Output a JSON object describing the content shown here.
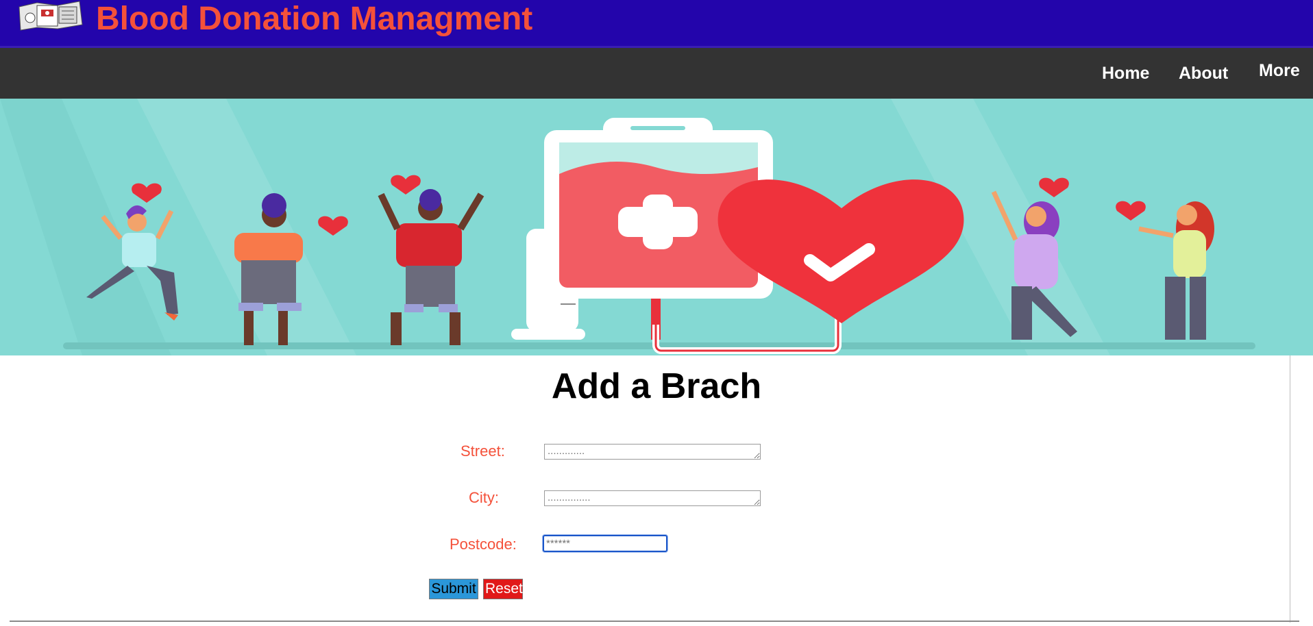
{
  "header": {
    "title": "Blood Donation Managment",
    "logo_icon": "blood-donation-logo-icon",
    "background": "#2305ab",
    "title_color": "#f4513a"
  },
  "nav": {
    "items": [
      {
        "label": "Home"
      },
      {
        "label": "About"
      },
      {
        "label": "More"
      }
    ],
    "background": "#333333"
  },
  "banner": {
    "illustration": "blood-donation-banner-illustration",
    "background": "#84d9d3"
  },
  "main": {
    "heading": "Add a Brach"
  },
  "form": {
    "street_label": "Street:",
    "street_placeholder": ".............",
    "city_label": "City:",
    "city_placeholder": "...............",
    "postcode_label": "Postcode:",
    "postcode_placeholder": "******",
    "label_color": "#f4513a",
    "submit_label": "Submit",
    "reset_label": "Reset"
  }
}
